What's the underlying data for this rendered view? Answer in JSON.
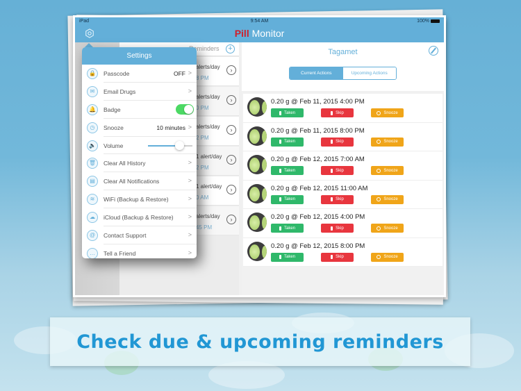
{
  "status_bar": {
    "device": "iPad",
    "time": "9:54 AM",
    "battery": "100%"
  },
  "app": {
    "title_prefix": "Pill",
    "title_suffix": "Monitor"
  },
  "left_list": {
    "header_label": "Reminders",
    "rows": [
      {
        "frequency": "alerts/day",
        "time": "8 PM"
      },
      {
        "frequency": "alerts/day",
        "time": "0 PM"
      },
      {
        "frequency": "alerts/day",
        "time": "2 PM"
      },
      {
        "frequency": "1 alert/day",
        "time": "2 PM"
      },
      {
        "frequency": "1 alert/day",
        "time": "0 AM"
      },
      {
        "frequency": "alerts/day",
        "time": "45 PM"
      }
    ]
  },
  "settings": {
    "title": "Settings",
    "items": [
      {
        "label": "Passcode",
        "value": "OFF",
        "icon": "lock-icon",
        "glyph": "🔒",
        "type": "value"
      },
      {
        "label": "Email Drugs",
        "value": "",
        "icon": "envelope-icon",
        "glyph": "✉",
        "type": "link"
      },
      {
        "label": "Badge",
        "value": "on",
        "icon": "bell-icon",
        "glyph": "🔔",
        "type": "toggle"
      },
      {
        "label": "Snooze",
        "value": "10 minutes",
        "icon": "clock-icon",
        "glyph": "◷",
        "type": "value"
      },
      {
        "label": "Volume",
        "value": 0.7,
        "icon": "speaker-icon",
        "glyph": "🔈",
        "type": "slider"
      },
      {
        "label": "Clear All History",
        "value": "",
        "icon": "trash-icon",
        "glyph": "🗑",
        "type": "link"
      },
      {
        "label": "Clear All Notifications",
        "value": "",
        "icon": "notification-icon",
        "glyph": "▤",
        "type": "link"
      },
      {
        "label": "WiFi (Backup & Restore)",
        "value": "",
        "icon": "wifi-icon",
        "glyph": "≋",
        "type": "link"
      },
      {
        "label": "iCloud (Backup & Restore)",
        "value": "",
        "icon": "cloud-icon",
        "glyph": "☁",
        "type": "link"
      },
      {
        "label": "Contact Support",
        "value": "",
        "icon": "at-icon",
        "glyph": "@",
        "type": "link"
      },
      {
        "label": "Tell a Friend",
        "value": "",
        "icon": "chat-icon",
        "glyph": "…",
        "type": "link"
      }
    ]
  },
  "detail": {
    "drug_name": "Tagamet",
    "tabs": [
      {
        "label": "Current Actions",
        "active": true
      },
      {
        "label": "Upcoming Actions",
        "active": false
      }
    ],
    "buttons": {
      "taken": "Taken",
      "skip": "Skip",
      "snooze": "Snooze"
    },
    "actions": [
      {
        "dose": "0.20 g @ Feb 11, 2015 4:00 PM"
      },
      {
        "dose": "0.20 g @ Feb 11, 2015 8:00 PM"
      },
      {
        "dose": "0.20 g @ Feb 12, 2015 7:00 AM"
      },
      {
        "dose": "0.20 g @ Feb 12, 2015 11:00 AM"
      },
      {
        "dose": "0.20 g @ Feb 12, 2015 4:00 PM"
      },
      {
        "dose": "0.20 g @ Feb 12, 2015 8:00 PM"
      }
    ]
  },
  "caption": "Check due & upcoming reminders",
  "colors": {
    "accent": "#63afd9",
    "pill_red": "#cf1f2a",
    "taken": "#2fb86a",
    "skip": "#e8363e",
    "snooze": "#f0a519",
    "toggle_on": "#4cd964",
    "caption": "#2197d4"
  }
}
